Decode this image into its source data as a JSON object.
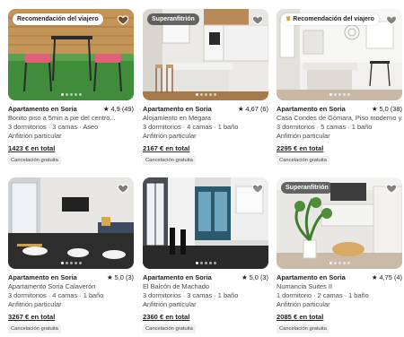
{
  "colors": {
    "text": "#222222",
    "secondary": "#4a4a4a",
    "chip_bg": "#f0f0f0"
  },
  "listings": [
    {
      "badge": "Recomendación del viajero",
      "badge_icon": "",
      "title": "Apartamento en Soria",
      "rating": "★ 4,9 (49)",
      "description": "Bonito piso a 5min a pie del centro...",
      "rooms": "3 dormitorios · 3 camas · Aseo",
      "host": "Anfitrión particular",
      "price": "1423 € en total",
      "cancellation": "Cancelación gratuita",
      "carousel_position": 1
    },
    {
      "badge": "Superanfitrión",
      "badge_icon": "",
      "title": "Apartamento en Soria",
      "rating": "★ 4,67 (6)",
      "description": "Alojamiento en Megara",
      "rooms": "3 dormitorios · 4 camas · 1 baño",
      "host": "Anfitrión particular",
      "price": "2167 € en total",
      "cancellation": "Cancelación gratuita",
      "carousel_position": 1
    },
    {
      "badge": "Recomendación del viajero",
      "badge_icon": "trophy-icon",
      "title": "Apartamento en Soria",
      "rating": "★ 5,0 (38)",
      "description": "Casa Condes de Gómara, Piso moderno y...",
      "rooms": "3 dormitorios · 5 camas · 1 baño",
      "host": "Anfitrión particular",
      "price": "2295 € en total",
      "cancellation": "Cancelación gratuita",
      "carousel_position": 1
    },
    {
      "badge": "",
      "badge_icon": "",
      "title": "Apartamento en Soria",
      "rating": "★ 5,0 (3)",
      "description": "Apartamento Soria Calaverón",
      "rooms": "3 dormitorios · 4 camas · 1 baño",
      "host": "Anfitrión particular",
      "price": "3267 € en total",
      "cancellation": "Cancelación gratuita",
      "carousel_position": 1
    },
    {
      "badge": "",
      "badge_icon": "",
      "title": "Apartamento en Soria",
      "rating": "★ 5,0 (3)",
      "description": "El Balcón de Machado",
      "rooms": "3 dormitorios · 3 camas · 1 baño",
      "host": "Anfitrión particular",
      "price": "2360 € en total",
      "cancellation": "Cancelación gratuita",
      "carousel_position": 1
    },
    {
      "badge": "Superanfitrión",
      "badge_icon": "",
      "title": "Apartamento en Soria",
      "rating": "★ 4,75 (4)",
      "description": "Numancia Suites II",
      "rooms": "1 dormitorio · 2 camas · 1 baño",
      "host": "Anfitrión particular",
      "price": "2085 € en total",
      "cancellation": "Cancelación gratuita",
      "carousel_position": 1
    }
  ]
}
